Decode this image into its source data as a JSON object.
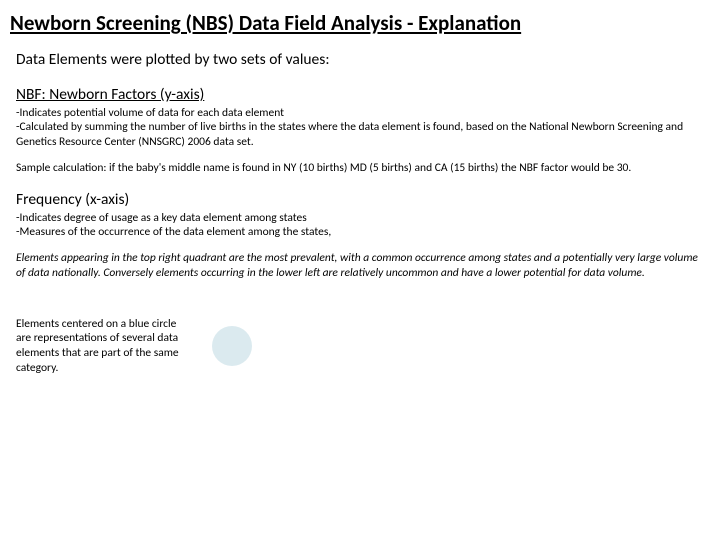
{
  "title": "Newborn Screening (NBS) Data Field Analysis - Explanation",
  "intro": "Data Elements were plotted by two sets of values:",
  "nbf": {
    "heading": "NBF: Newborn Factors (y-axis)",
    "line1": "-Indicates potential volume of data for each data element",
    "line2": "-Calculated by summing the number of live births in the states where the data element is found, based on the National Newborn Screening and Genetics Resource Center (NNSGRC) 2006 data set.",
    "sample": "Sample calculation: if the baby's middle name is found in NY (10 births) MD (5 births) and CA (15 births) the NBF factor would be 30."
  },
  "freq": {
    "heading": "Frequency (x-axis)",
    "line1": "-Indicates degree of usage as a key data element among states",
    "line2": "-Measures of the occurrence of the data element among the states,"
  },
  "quadrant": "Elements appearing in the top right quadrant are the most prevalent, with a common occurrence among states and  a potentially very large volume of data nationally.  Conversely elements occurring in the lower left are relatively uncommon and have a lower potential for data volume.",
  "legend": "Elements centered on a blue circle are representations of several data elements that are part of the same category."
}
